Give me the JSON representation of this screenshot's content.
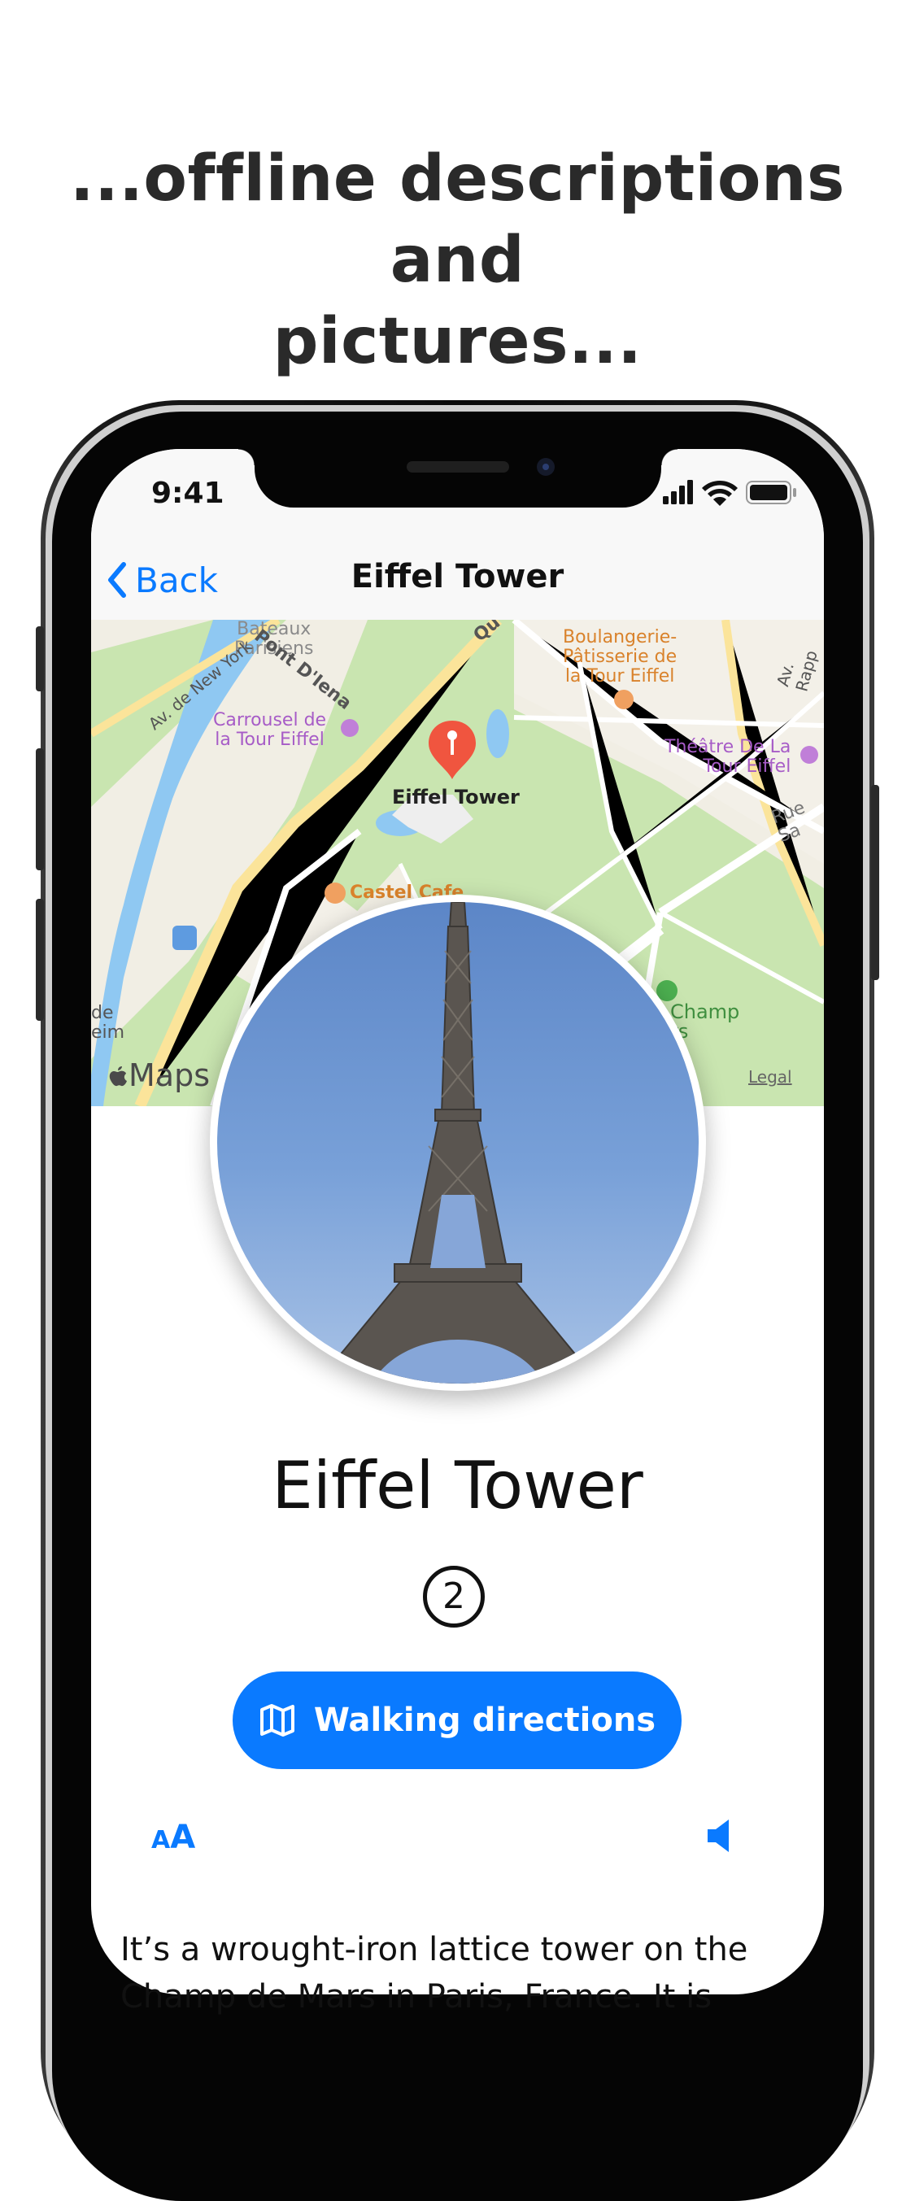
{
  "headline": {
    "line1": "...offline descriptions and",
    "line2": "pictures..."
  },
  "status_bar": {
    "time": "9:41",
    "icons": [
      "signal-icon",
      "wifi-icon",
      "battery-icon"
    ]
  },
  "nav": {
    "back_label": "Back",
    "title": "Eiffel Tower"
  },
  "map": {
    "labels": {
      "bateaux": "Bateaux\nParisiens",
      "pont": "Pont D'Iena",
      "av_new_york": "Av. de New York",
      "boulangerie": "Boulangerie-\nPâtisserie de\nla Tour Eiffel",
      "av_rapp": "Av. Rapp",
      "carrousel": "Carrousel de\nla Tour Eiffel",
      "theatre": "Théâtre De La\nTour Eiffel",
      "rue": "Rue Sa",
      "pin": "Eiffel Tower",
      "castel": "Castel Cafe",
      "champ": "Champ\nrs",
      "de": "de\neim",
      "qu": "Qu"
    },
    "maps_label": "Maps",
    "legal": "Legal"
  },
  "place": {
    "name": "Eiffel Tower",
    "number": "2"
  },
  "walking_button": "Walking directions",
  "description": "It’s a wrought-iron lattice tower on the Champ de Mars in Paris, France. It is",
  "colors": {
    "accent": "#0a7aff",
    "pin": "#f0553f",
    "park": "#c9e5b0",
    "water": "#8fc8f2"
  }
}
